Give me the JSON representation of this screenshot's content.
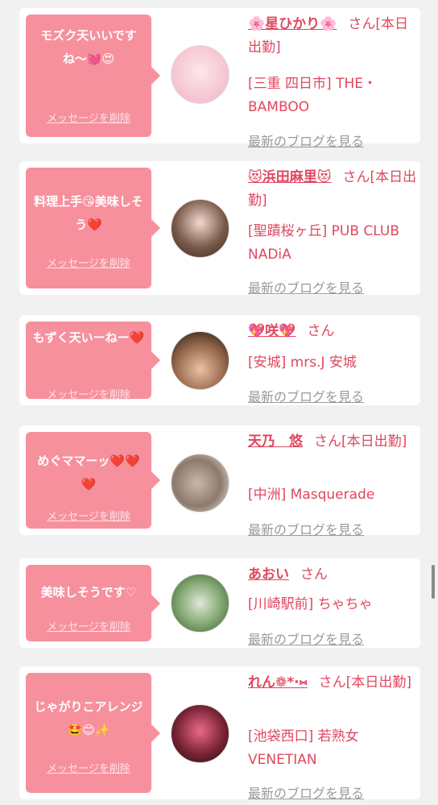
{
  "messages": [
    {
      "message": "モズク天いいですね〜💓😍",
      "delete_label": "メッセージを削除",
      "girl_name": "🌸星ひかり🌸",
      "honorific": "さん[本日出勤]",
      "shop": "[三重 四日市] THE・BAMBOO",
      "blog_link": "最新のブログを見る",
      "avatar_icon": "avatar-photo-icon"
    },
    {
      "message": "料理上手😘美味しそう❤️",
      "delete_label": "メッセージを削除",
      "girl_name": "😻浜田麻里😻",
      "honorific": "さん[本日出勤]",
      "shop": "[聖蹟桜ヶ丘] PUB CLUB NADiA",
      "blog_link": "最新のブログを見る",
      "avatar_icon": "avatar-photo-icon"
    },
    {
      "message": "もずく天いーねー❤️",
      "delete_label": "メッセージを削除",
      "girl_name": "💖咲💖",
      "honorific": "さん",
      "shop": "[安城] mrs.J 安城",
      "blog_link": "最新のブログを見る",
      "avatar_icon": "avatar-photo-icon"
    },
    {
      "message": "めぐママーッ❤️❤️❤️",
      "delete_label": "メッセージを削除",
      "girl_name": "天乃　悠",
      "honorific": "さん[本日出勤]",
      "shop": "[中洲] Masquerade",
      "blog_link": "最新のブログを見る",
      "avatar_icon": "avatar-photo-icon"
    },
    {
      "message": "美味しそうです♡",
      "delete_label": "メッセージを削除",
      "girl_name": "あおい",
      "honorific": "さん",
      "shop": "[川崎駅前] ちゃちゃ",
      "blog_link": "最新のブログを見る",
      "avatar_icon": "avatar-photo-icon"
    },
    {
      "message": "じゃがりこアレンジ🤩😊✨",
      "delete_label": "メッセージを削除",
      "girl_name": "れん❁*·⑅",
      "honorific": "さん[本日出勤]",
      "shop": "[池袋西口] 若熟女VENETIAN",
      "blog_link": "最新のブログを見る",
      "avatar_icon": "avatar-photo-icon"
    }
  ],
  "colors": {
    "accent": "#e0475e",
    "bubble": "#f7909d",
    "link_gray": "#9a9a9a",
    "background": "#f1f1f1"
  }
}
